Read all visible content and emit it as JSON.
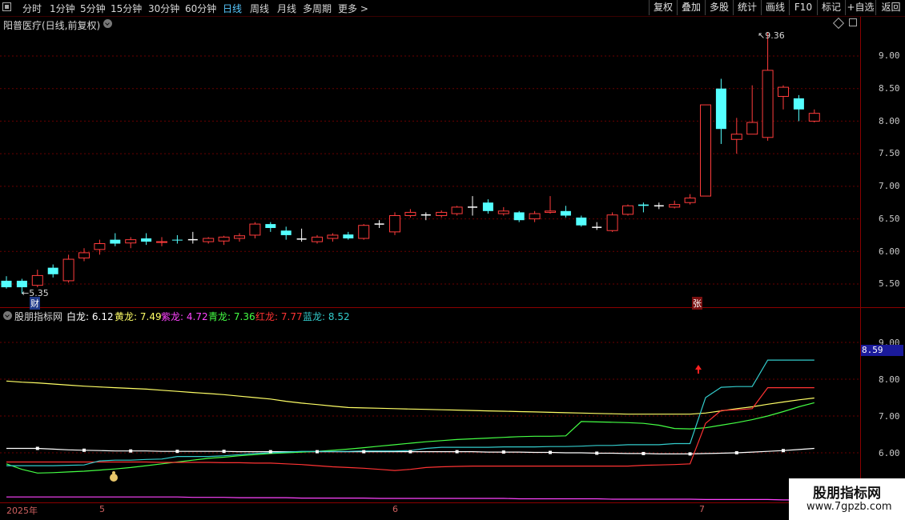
{
  "toolbar": {
    "periods": [
      "分时",
      "1分钟",
      "5分钟",
      "15分钟",
      "30分钟",
      "60分钟",
      "日线",
      "周线",
      "月线",
      "多周期",
      "更多 >"
    ],
    "active_period": "日线",
    "right_buttons": [
      "复权",
      "叠加",
      "多股",
      "统计",
      "画线",
      "F10",
      "标记",
      "+自选",
      "返回"
    ]
  },
  "main_chart": {
    "title": "阳普医疗(日线,前复权)",
    "y_ticks": [
      "9.00",
      "8.50",
      "8.00",
      "7.50",
      "7.00",
      "6.50",
      "6.00",
      "5.50"
    ],
    "high_label": "9.36",
    "low_label": "5.35",
    "cai_badge": "财",
    "zhang_badge": "张"
  },
  "indicator": {
    "title": "股朋指标网",
    "legend": [
      {
        "name": "白龙:",
        "value": "6.12",
        "color": "#ffffff"
      },
      {
        "name": "黄龙:",
        "value": "7.49",
        "color": "#ffff66"
      },
      {
        "name": "紫龙:",
        "value": "4.72",
        "color": "#ff44ff"
      },
      {
        "name": "青龙:",
        "value": "7.36",
        "color": "#44ff44"
      },
      {
        "name": "红龙:",
        "value": "7.77",
        "color": "#ff3333"
      },
      {
        "name": "蓝龙:",
        "value": "8.52",
        "color": "#33cccc"
      }
    ],
    "y_ticks": [
      "9.00",
      "8.00",
      "7.00",
      "6.00"
    ],
    "current_value": "8.59"
  },
  "date_axis": [
    "2025年",
    "5",
    "6",
    "7"
  ],
  "watermark": {
    "line1": "股朋指标网",
    "line2": "www.7gpzb.com"
  },
  "chart_data": [
    {
      "type": "candlestick",
      "title": "阳普医疗(日线,前复权)",
      "ylim": [
        5.2,
        9.6
      ],
      "candles": [
        [
          5.55,
          5.45,
          5.62,
          5.43
        ],
        [
          5.55,
          5.45,
          5.58,
          5.35
        ],
        [
          5.48,
          5.63,
          5.72,
          5.45
        ],
        [
          5.75,
          5.65,
          5.8,
          5.6
        ],
        [
          5.55,
          5.88,
          5.95,
          5.52
        ],
        [
          5.9,
          5.98,
          6.05,
          5.85
        ],
        [
          6.03,
          6.12,
          6.18,
          5.95
        ],
        [
          6.18,
          6.12,
          6.28,
          6.08
        ],
        [
          6.13,
          6.18,
          6.22,
          6.05
        ],
        [
          6.2,
          6.15,
          6.28,
          6.1
        ],
        [
          6.14,
          6.15,
          6.22,
          6.08
        ],
        [
          6.18,
          6.17,
          6.25,
          6.12
        ],
        [
          6.18,
          6.18,
          6.3,
          6.12
        ],
        [
          6.15,
          6.2,
          6.22,
          6.12
        ],
        [
          6.16,
          6.22,
          6.24,
          6.1
        ],
        [
          6.2,
          6.24,
          6.28,
          6.15
        ],
        [
          6.25,
          6.42,
          6.45,
          6.2
        ],
        [
          6.42,
          6.36,
          6.45,
          6.3
        ],
        [
          6.32,
          6.25,
          6.38,
          6.18
        ],
        [
          6.19,
          6.19,
          6.35,
          6.15
        ],
        [
          6.15,
          6.22,
          6.25,
          6.12
        ],
        [
          6.2,
          6.25,
          6.28,
          6.15
        ],
        [
          6.26,
          6.2,
          6.3,
          6.18
        ],
        [
          6.2,
          6.4,
          6.42,
          6.18
        ],
        [
          6.42,
          6.42,
          6.48,
          6.36
        ],
        [
          6.3,
          6.55,
          6.6,
          6.25
        ],
        [
          6.55,
          6.6,
          6.65,
          6.52
        ],
        [
          6.56,
          6.56,
          6.6,
          6.48
        ],
        [
          6.55,
          6.6,
          6.63,
          6.52
        ],
        [
          6.58,
          6.68,
          6.7,
          6.55
        ],
        [
          6.68,
          6.68,
          6.85,
          6.55
        ],
        [
          6.75,
          6.62,
          6.8,
          6.58
        ],
        [
          6.58,
          6.62,
          6.68,
          6.55
        ],
        [
          6.6,
          6.48,
          6.62,
          6.45
        ],
        [
          6.5,
          6.58,
          6.62,
          6.45
        ],
        [
          6.6,
          6.62,
          6.85,
          6.58
        ],
        [
          6.62,
          6.55,
          6.7,
          6.52
        ],
        [
          6.52,
          6.4,
          6.55,
          6.38
        ],
        [
          6.37,
          6.37,
          6.45,
          6.33
        ],
        [
          6.32,
          6.56,
          6.6,
          6.3
        ],
        [
          6.57,
          6.7,
          6.72,
          6.55
        ],
        [
          6.72,
          6.7,
          6.75,
          6.6
        ],
        [
          6.7,
          6.7,
          6.75,
          6.65
        ],
        [
          6.68,
          6.72,
          6.78,
          6.66
        ],
        [
          6.75,
          6.82,
          6.88,
          6.72
        ],
        [
          6.85,
          8.25,
          8.25,
          6.85
        ],
        [
          8.5,
          7.88,
          8.65,
          7.65
        ],
        [
          7.72,
          7.8,
          8.05,
          7.5
        ],
        [
          7.8,
          7.98,
          8.55,
          7.8
        ],
        [
          7.75,
          8.78,
          9.36,
          7.7
        ],
        [
          8.38,
          8.52,
          8.55,
          8.18
        ],
        [
          8.35,
          8.18,
          8.4,
          8.0
        ],
        [
          8.0,
          8.12,
          8.18,
          7.98
        ]
      ]
    },
    {
      "type": "line",
      "title": "股朋指标网",
      "ylim": [
        4.6,
        9.6
      ],
      "series": [
        {
          "name": "白龙",
          "color": "#ffffff",
          "values": [
            6.12,
            6.12,
            6.12,
            6.1,
            6.08,
            6.07,
            6.06,
            6.05,
            6.05,
            6.05,
            6.04,
            6.04,
            6.04,
            6.04,
            6.04,
            6.03,
            6.03,
            6.03,
            6.03,
            6.03,
            6.03,
            6.03,
            6.03,
            6.03,
            6.03,
            6.03,
            6.03,
            6.03,
            6.03,
            6.03,
            6.03,
            6.02,
            6.02,
            6.02,
            6.01,
            6.01,
            6.0,
            6.0,
            5.99,
            5.99,
            5.98,
            5.98,
            5.97,
            5.97,
            5.97,
            5.98,
            5.99,
            6.0,
            6.02,
            6.04,
            6.06,
            6.09,
            6.12
          ]
        },
        {
          "name": "黄龙",
          "color": "#ffff66",
          "values": [
            7.95,
            7.92,
            7.9,
            7.87,
            7.84,
            7.81,
            7.79,
            7.77,
            7.75,
            7.73,
            7.7,
            7.67,
            7.64,
            7.61,
            7.58,
            7.54,
            7.5,
            7.46,
            7.4,
            7.35,
            7.31,
            7.27,
            7.23,
            7.22,
            7.21,
            7.2,
            7.19,
            7.18,
            7.17,
            7.16,
            7.15,
            7.14,
            7.13,
            7.12,
            7.11,
            7.1,
            7.09,
            7.08,
            7.07,
            7.06,
            7.05,
            7.05,
            7.05,
            7.05,
            7.05,
            7.08,
            7.14,
            7.2,
            7.25,
            7.32,
            7.38,
            7.44,
            7.49
          ]
        },
        {
          "name": "紫龙",
          "color": "#ff44ff",
          "values": [
            4.8,
            4.8,
            4.8,
            4.8,
            4.8,
            4.8,
            4.8,
            4.8,
            4.8,
            4.8,
            4.8,
            4.8,
            4.79,
            4.79,
            4.79,
            4.78,
            4.78,
            4.78,
            4.78,
            4.77,
            4.77,
            4.77,
            4.77,
            4.77,
            4.76,
            4.76,
            4.76,
            4.76,
            4.76,
            4.76,
            4.76,
            4.76,
            4.76,
            4.75,
            4.75,
            4.75,
            4.75,
            4.75,
            4.75,
            4.74,
            4.74,
            4.74,
            4.74,
            4.74,
            4.74,
            4.73,
            4.73,
            4.73,
            4.73,
            4.73,
            4.72,
            4.72,
            4.72
          ]
        },
        {
          "name": "青龙",
          "color": "#44ff44",
          "values": [
            5.7,
            5.55,
            5.45,
            5.46,
            5.48,
            5.5,
            5.53,
            5.56,
            5.6,
            5.65,
            5.7,
            5.75,
            5.8,
            5.85,
            5.88,
            5.92,
            5.95,
            5.98,
            6.0,
            6.02,
            6.04,
            6.07,
            6.1,
            6.14,
            6.18,
            6.22,
            6.26,
            6.3,
            6.33,
            6.36,
            6.38,
            6.4,
            6.42,
            6.44,
            6.45,
            6.45,
            6.46,
            6.85,
            6.84,
            6.83,
            6.82,
            6.8,
            6.75,
            6.66,
            6.65,
            6.68,
            6.75,
            6.82,
            6.9,
            7.0,
            7.12,
            7.25,
            7.36
          ]
        },
        {
          "name": "红龙",
          "color": "#ff3333",
          "values": [
            5.75,
            5.75,
            5.75,
            5.75,
            5.75,
            5.75,
            5.75,
            5.75,
            5.75,
            5.75,
            5.74,
            5.74,
            5.74,
            5.74,
            5.73,
            5.73,
            5.72,
            5.72,
            5.7,
            5.68,
            5.65,
            5.62,
            5.6,
            5.58,
            5.55,
            5.52,
            5.55,
            5.6,
            5.62,
            5.63,
            5.64,
            5.64,
            5.64,
            5.64,
            5.64,
            5.64,
            5.64,
            5.64,
            5.64,
            5.64,
            5.64,
            5.66,
            5.67,
            5.68,
            5.7,
            6.8,
            7.15,
            7.17,
            7.2,
            7.77,
            7.77,
            7.77,
            7.77
          ]
        },
        {
          "name": "蓝龙",
          "color": "#33cccc",
          "values": [
            5.65,
            5.65,
            5.65,
            5.65,
            5.66,
            5.67,
            5.78,
            5.8,
            5.8,
            5.82,
            5.83,
            5.9,
            5.9,
            5.9,
            5.92,
            5.95,
            5.98,
            6.0,
            6.02,
            6.04,
            6.04,
            6.04,
            6.04,
            6.05,
            6.05,
            6.05,
            6.06,
            6.12,
            6.15,
            6.15,
            6.15,
            6.15,
            6.16,
            6.16,
            6.16,
            6.17,
            6.17,
            6.18,
            6.2,
            6.2,
            6.22,
            6.22,
            6.22,
            6.25,
            6.25,
            7.5,
            7.78,
            7.8,
            7.8,
            8.52,
            8.52,
            8.52,
            8.52
          ]
        }
      ]
    }
  ]
}
